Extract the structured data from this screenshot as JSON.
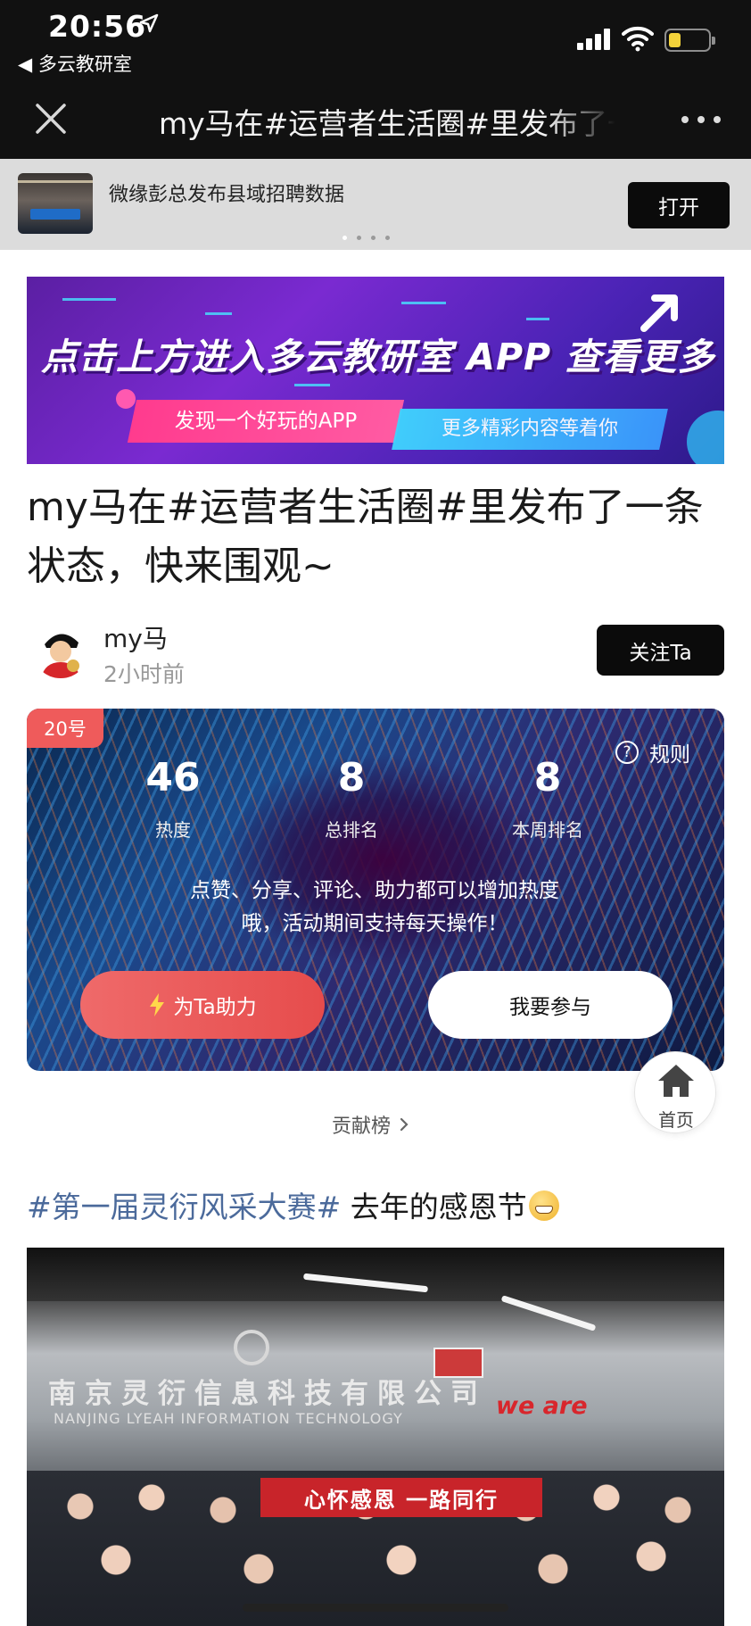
{
  "status_bar": {
    "time": "20:56",
    "location_icon": "location-arrow-icon",
    "back_app": "◀ 多云教研室"
  },
  "nav": {
    "title": "my马在#运营者生活圈#里发布了一条状态，快来围观~",
    "close_icon": "close-icon",
    "more_icon": "more-icon"
  },
  "promo": {
    "text": "微缘彭总发布县域招聘数据",
    "open_label": "打开"
  },
  "ad_banner": {
    "headline": "点击上方进入多云教研室 APP 查看更多",
    "pill_left": "发现一个好玩的APP",
    "pill_right": "更多精彩内容等着你"
  },
  "post": {
    "title": "my马在#运营者生活圈#里发布了一条状态，快来围观~"
  },
  "author": {
    "name": "my马",
    "time": "2小时前",
    "follow_label": "关注Ta"
  },
  "stats_card": {
    "badge": "20号",
    "rules_label": "规则",
    "stats": [
      {
        "value": "46",
        "label": "热度"
      },
      {
        "value": "8",
        "label": "总排名"
      },
      {
        "value": "8",
        "label": "本周排名"
      }
    ],
    "description_line1": "点赞、分享、评论、助力都可以增加热度",
    "description_line2": "哦，活动期间支持每天操作！",
    "help_label": "为Ta助力",
    "join_label": "我要参与"
  },
  "home_float": {
    "label": "首页"
  },
  "contribution": {
    "label": "贡献榜"
  },
  "next_post": {
    "tag": "#第一届灵衍风采大赛#",
    "text": " 去年的感恩节"
  },
  "photo": {
    "wall_text": "南京灵衍信息科技有限公司",
    "wall_sub": "NANJING LYEAH INFORMATION TECHNOLOGY",
    "banner_text": "心怀感恩  一路同行",
    "weare_text": "we are"
  },
  "colors": {
    "nav_bg": "#111111",
    "follow_bg": "#0b0b0b",
    "badge": "#ef5b5b",
    "help_button": "#e64c4c",
    "tag_link": "#4b6a9b"
  }
}
